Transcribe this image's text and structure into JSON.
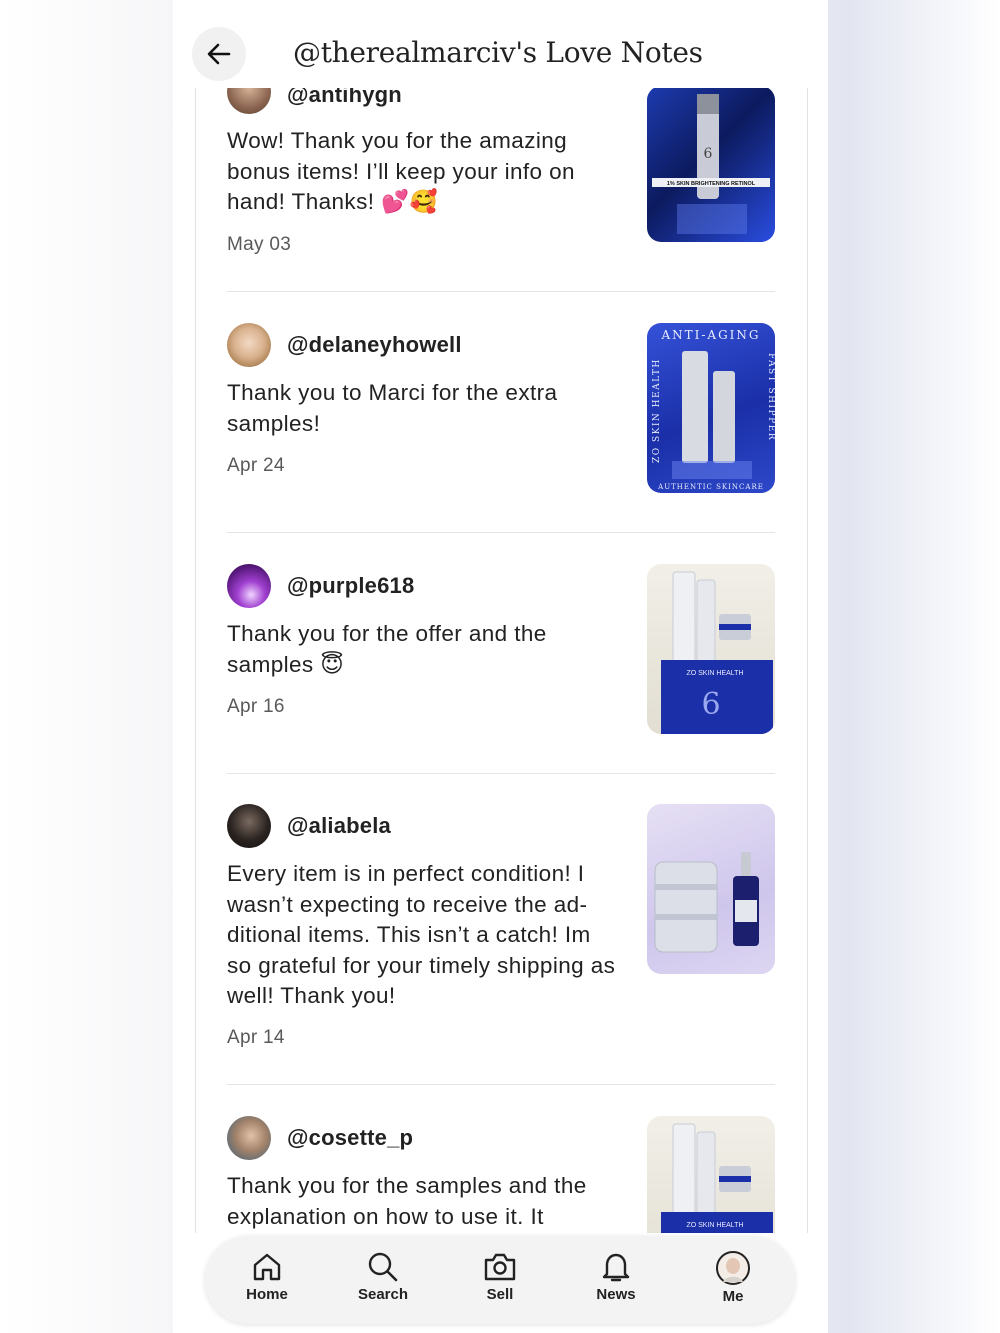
{
  "header": {
    "title": "@therealmarciv's Love Notes"
  },
  "notes": [
    {
      "username": "@antihygn",
      "message": "Wow! Thank you for the amazing bonus items! I’ll keep your info on hand! Thanks! 💕🥰",
      "date": "May 03",
      "image_text": "1% SKIN BRIGHTENING RETINOL"
    },
    {
      "username": "@delaneyhowell",
      "message": "Thank you to Marci for the extra samples!",
      "date": "Apr 24",
      "image_text_top": "ANTI-AGING",
      "image_text_left": "ZO SKIN HEALTH",
      "image_text_right": "FAST SHIPPER",
      "image_text_bottom": "AUTHENTIC SKINCARE"
    },
    {
      "username": "@purple618",
      "message": "Thank you for the offer and the samples 😇",
      "date": "Apr 16",
      "image_text": "ZO SKIN HEALTH"
    },
    {
      "username": "@aliabela",
      "message": "Every item is in perfect condition! I wasn’t expecting to receive the ad-ditional items. This isn’t a catch! Im so grateful for your timely shipping as well! Thank you!",
      "date": "Apr 14"
    },
    {
      "username": "@cosette_p",
      "message": "Thank you for the samples and the explanation on how to use it. It",
      "date": "",
      "image_text": "ZO SKIN HEALTH"
    }
  ],
  "nav": [
    {
      "label": "Home",
      "icon": "home-icon"
    },
    {
      "label": "Search",
      "icon": "search-icon"
    },
    {
      "label": "Sell",
      "icon": "camera-icon"
    },
    {
      "label": "News",
      "icon": "bell-icon"
    },
    {
      "label": "Me",
      "icon": "avatar"
    }
  ],
  "colors": {
    "brand_blue": "#1a2fa8",
    "text": "#222222",
    "muted": "#595959"
  }
}
